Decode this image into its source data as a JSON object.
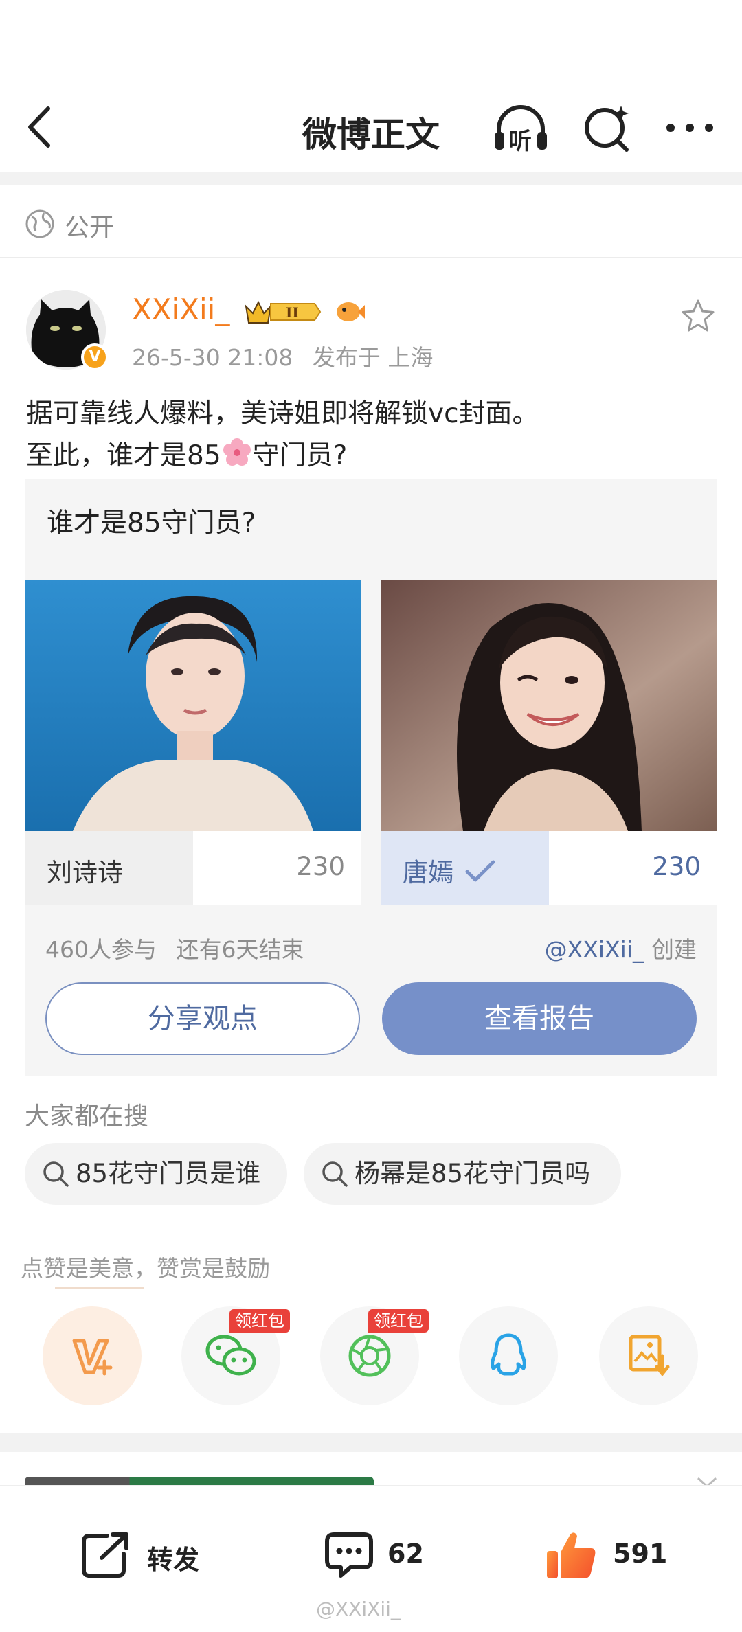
{
  "header": {
    "title": "微博正文",
    "listen_label": "听"
  },
  "visibility": {
    "label": "公开"
  },
  "post": {
    "author": "XXiXii_",
    "rank_badge": "II",
    "time": "26-5-30 21:08",
    "location": "发布于 上海",
    "line1": "据可靠线人爆料，美诗姐即将解锁vc封面。",
    "line2_prefix": "至此，谁才是85",
    "line2_suffix": "守门员?"
  },
  "vote": {
    "question": "谁才是85守门员?",
    "options": [
      {
        "name": "刘诗诗",
        "count": "230",
        "share": 0.5,
        "selected": false
      },
      {
        "name": "唐嫣",
        "count": "230",
        "share": 0.5,
        "selected": true
      }
    ],
    "participants": "460人参与",
    "remaining": "还有6天结束",
    "creator_handle": "@XXiXii_",
    "creator_suffix": "创建",
    "share_button": "分享观点",
    "report_button": "查看报告"
  },
  "search": {
    "title": "大家都在搜",
    "chips": [
      "85花守门员是谁",
      "杨幂是85花守门员吗"
    ]
  },
  "reward": {
    "title": "点赞是美意，赞赏是鼓励",
    "red_packet_badge": "领红包"
  },
  "actions": {
    "repost_label": "转发",
    "comment_count": "62",
    "like_count": "591"
  },
  "watermark": "@XXiXii_",
  "colors": {
    "accent_orange": "#f37b1d",
    "vote_blue": "#7690c9",
    "link_blue": "#4f6aa0",
    "red_badge": "#e9413a"
  }
}
